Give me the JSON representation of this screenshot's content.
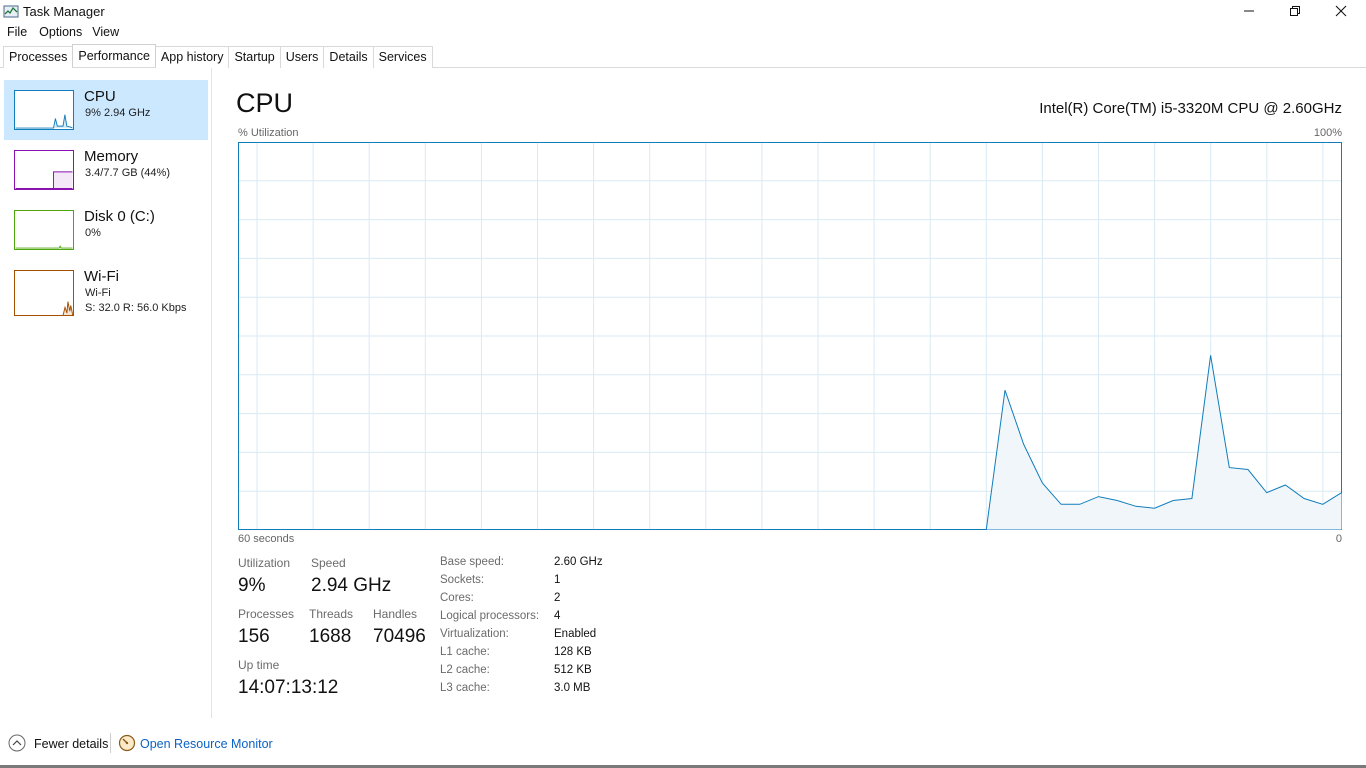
{
  "window": {
    "title": "Task Manager",
    "icon": "task-manager-icon"
  },
  "menu": [
    "File",
    "Options",
    "View"
  ],
  "tabs": [
    {
      "label": "Processes",
      "active": false
    },
    {
      "label": "Performance",
      "active": true
    },
    {
      "label": "App history",
      "active": false
    },
    {
      "label": "Startup",
      "active": false
    },
    {
      "label": "Users",
      "active": false
    },
    {
      "label": "Details",
      "active": false
    },
    {
      "label": "Services",
      "active": false
    }
  ],
  "sidebar": {
    "items": [
      {
        "title": "CPU",
        "line1": "9%  2.94 GHz",
        "line2": "",
        "color": "#117dbb",
        "selected": true
      },
      {
        "title": "Memory",
        "line1": "3.4/7.7 GB (44%)",
        "line2": "",
        "color": "#8b12ae",
        "selected": false
      },
      {
        "title": "Disk 0 (C:)",
        "line1": "0%",
        "line2": "",
        "color": "#4da60c",
        "selected": false
      },
      {
        "title": "Wi-Fi",
        "line1": "Wi-Fi",
        "line2": "S: 32.0  R: 56.0 Kbps",
        "color": "#a74f01",
        "selected": false
      }
    ]
  },
  "main": {
    "title": "CPU",
    "cpu_model": "Intel(R) Core(TM) i5-3320M CPU @ 2.60GHz",
    "util_label": "% Utilization",
    "util_max": "100%",
    "time_label": "60 seconds",
    "time_zero": "0"
  },
  "chart_data": {
    "type": "area",
    "x": [
      0,
      1,
      2,
      3,
      4,
      5,
      6,
      7,
      8,
      9,
      10,
      11,
      12,
      13,
      14,
      15,
      16,
      17,
      18,
      19,
      20,
      21,
      22,
      23,
      24,
      25,
      26,
      27,
      28,
      29,
      30,
      31,
      32,
      33,
      34,
      35,
      36,
      37,
      38,
      39,
      40,
      41,
      42,
      43,
      44,
      45,
      46,
      47,
      48,
      49,
      50,
      51,
      52,
      53,
      54,
      55,
      56,
      57,
      58,
      59
    ],
    "values": [
      0,
      0,
      0,
      0,
      0,
      0,
      0,
      0,
      0,
      0,
      0,
      0,
      0,
      0,
      0,
      0,
      0,
      0,
      0,
      0,
      0,
      0,
      0,
      0,
      0,
      0,
      0,
      0,
      0,
      0,
      0,
      0,
      0,
      0,
      0,
      0,
      0,
      0,
      0,
      0,
      0,
      36,
      22,
      12,
      6.5,
      6.5,
      8.5,
      7.5,
      6,
      5.5,
      7.5,
      8,
      45,
      16,
      15.5,
      9.5,
      11.5,
      8,
      6.5,
      9.5
    ],
    "ylim": [
      0,
      100
    ],
    "grid": true,
    "line_color": "#117dbb",
    "fill_color": "#f1f6fa"
  },
  "stats": {
    "utilization": {
      "label": "Utilization",
      "value": "9%"
    },
    "speed": {
      "label": "Speed",
      "value": "2.94 GHz"
    },
    "processes": {
      "label": "Processes",
      "value": "156"
    },
    "threads": {
      "label": "Threads",
      "value": "1688"
    },
    "handles": {
      "label": "Handles",
      "value": "70496"
    },
    "uptime": {
      "label": "Up time",
      "value": "14:07:13:12"
    }
  },
  "specs": [
    {
      "label": "Base speed:",
      "value": "2.60 GHz"
    },
    {
      "label": "Sockets:",
      "value": "1"
    },
    {
      "label": "Cores:",
      "value": "2"
    },
    {
      "label": "Logical processors:",
      "value": "4"
    },
    {
      "label": "Virtualization:",
      "value": "Enabled"
    },
    {
      "label": "L1 cache:",
      "value": "128 KB"
    },
    {
      "label": "L2 cache:",
      "value": "512 KB"
    },
    {
      "label": "L3 cache:",
      "value": "3.0 MB"
    }
  ],
  "footer": {
    "fewer_details": "Fewer details",
    "resource_monitor": "Open Resource Monitor"
  }
}
